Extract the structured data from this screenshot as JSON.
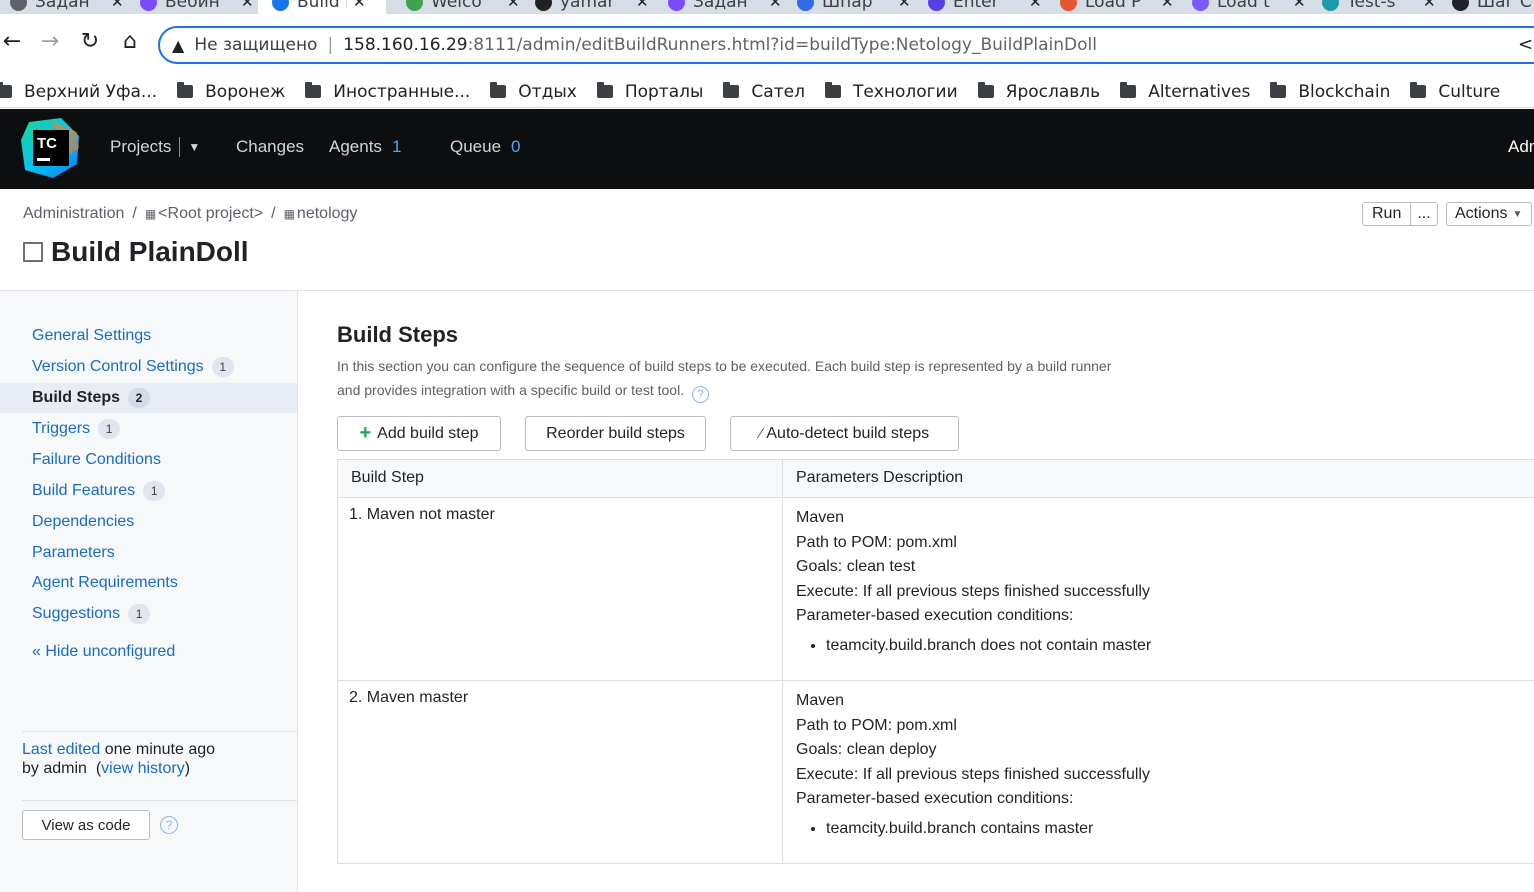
{
  "browser": {
    "tabs": [
      {
        "title": "Задан",
        "favicon_color": "#5f6368"
      },
      {
        "title": "Вебин",
        "favicon_color": "#7b4bff"
      },
      {
        "title": "Build P",
        "favicon_color": "#1a73e8"
      },
      {
        "title": "Welco",
        "favicon_color": "#3fa34d"
      },
      {
        "title": "yamar",
        "favicon_color": "#202124"
      },
      {
        "title": "Задан",
        "favicon_color": "#7b4bff"
      },
      {
        "title": "Шпар",
        "favicon_color": "#326ce5"
      },
      {
        "title": "Enter",
        "favicon_color": "#5b3fe6"
      },
      {
        "title": "Load P",
        "favicon_color": "#e5572e"
      },
      {
        "title": "Load t",
        "favicon_color": "#7a5af8"
      },
      {
        "title": "Test-s",
        "favicon_color": "#1b9aaa"
      },
      {
        "title": "Шаг С",
        "favicon_color": "#202124"
      }
    ],
    "address": {
      "warning": "Не защищено",
      "host": "158.160.16.29",
      "path": ":8111/admin/editBuildRunners.html?id=buildType:Netology_BuildPlainDoll"
    },
    "bookmarks": [
      "Верхний Уфа...",
      "Воронеж",
      "Иностранные...",
      "Отдых",
      "Порталы",
      "Сател",
      "Технологии",
      "Ярославль",
      "Alternatives",
      "Blockchain",
      "Culture"
    ]
  },
  "header": {
    "logo_text": "TC",
    "projects": "Projects",
    "changes": "Changes",
    "agents": "Agents",
    "agents_count": "1",
    "queue": "Queue",
    "queue_count": "0",
    "admin": "Adm"
  },
  "breadcrumb": {
    "admin": "Administration",
    "root": "<Root project>",
    "project": "netology"
  },
  "toolbar": {
    "run": "Run",
    "more": "...",
    "actions": "Actions"
  },
  "page": {
    "title": "Build PlainDoll"
  },
  "sidebar": {
    "items": [
      {
        "label": "General Settings",
        "badge": ""
      },
      {
        "label": "Version Control Settings",
        "badge": "1"
      },
      {
        "label": "Build Steps",
        "badge": "2"
      },
      {
        "label": "Triggers",
        "badge": "1"
      },
      {
        "label": "Failure Conditions",
        "badge": ""
      },
      {
        "label": "Build Features",
        "badge": "1"
      },
      {
        "label": "Dependencies",
        "badge": ""
      },
      {
        "label": "Parameters",
        "badge": ""
      },
      {
        "label": "Agent Requirements",
        "badge": ""
      },
      {
        "label": "Suggestions",
        "badge": "1"
      }
    ],
    "hide_unconfigured": "« Hide unconfigured",
    "last_edited_link": "Last edited",
    "last_edited_time": " one minute ago",
    "by_admin": "by admin",
    "open_paren": "(",
    "view_history": "view history",
    "close_paren": ")",
    "view_as_code": "View as code"
  },
  "main": {
    "title": "Build Steps",
    "description": "In this section you can configure the sequence of build steps to be executed. Each build step is represented by a build runner and provides integration with a specific build or test tool.",
    "add_step": "Add build step",
    "reorder": "Reorder build steps",
    "autodetect": "Auto-detect build steps",
    "table": {
      "col1": "Build Step",
      "col2": "Parameters Description",
      "rows": [
        {
          "name": "1. Maven not master",
          "runner": "Maven",
          "pom": "Path to POM: pom.xml",
          "goals": "Goals: clean test",
          "execute": "Execute: If all previous steps finished successfully",
          "cond_label": "Parameter-based execution conditions:",
          "condition": "teamcity.build.branch does not contain master"
        },
        {
          "name": "2. Maven master",
          "runner": "Maven",
          "pom": "Path to POM: pom.xml",
          "goals": "Goals: clean deploy",
          "execute": "Execute: If all previous steps finished successfully",
          "cond_label": "Parameter-based execution conditions:",
          "condition": "teamcity.build.branch contains master"
        }
      ]
    }
  }
}
